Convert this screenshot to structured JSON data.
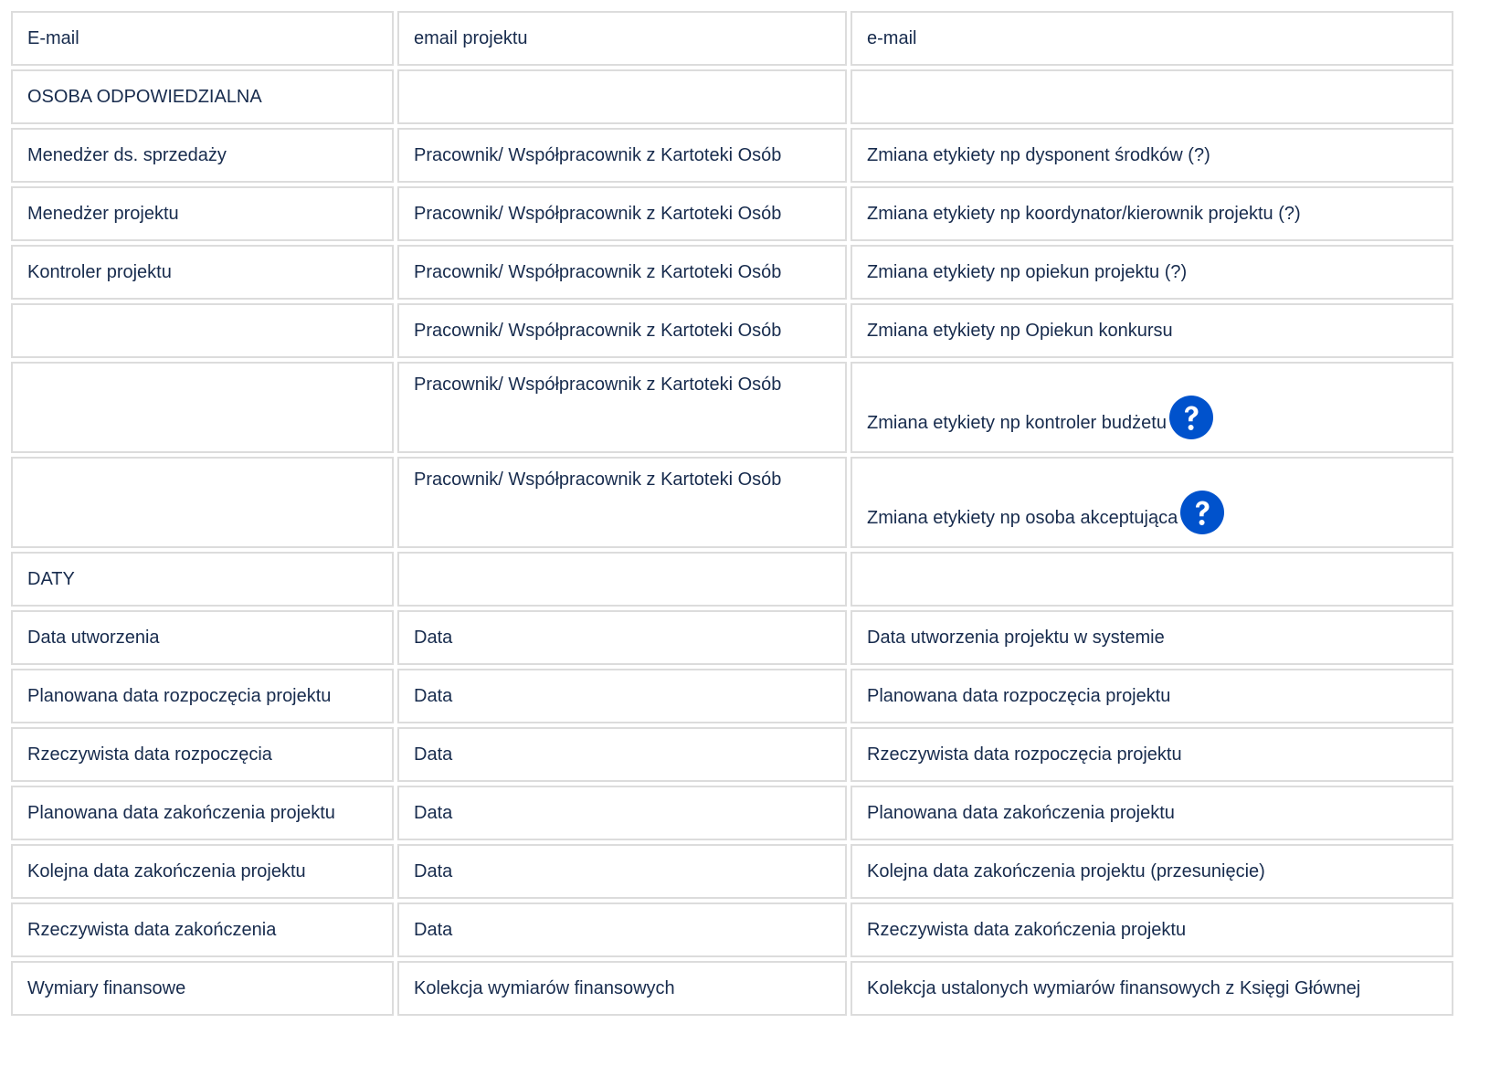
{
  "rows": [
    {
      "c1": "E-mail",
      "c2": "email projektu",
      "c3": "e-mail",
      "help": false
    },
    {
      "c1": "OSOBA ODPOWIEDZIALNA",
      "c2": "",
      "c3": "",
      "help": false
    },
    {
      "c1": "Menedżer ds. sprzedaży",
      "c2": "Pracownik/ Współpracownik z Kartoteki Osób",
      "c3": "Zmiana etykiety np dysponent środków (?)",
      "help": false
    },
    {
      "c1": "Menedżer projektu",
      "c2": "Pracownik/ Współpracownik z Kartoteki Osób",
      "c3": "Zmiana etykiety np koordynator/kierownik projektu (?)",
      "help": false
    },
    {
      "c1": "Kontroler projektu",
      "c2": "Pracownik/ Współpracownik z Kartoteki Osób",
      "c3": "Zmiana etykiety np opiekun projektu (?)",
      "help": false
    },
    {
      "c1": "",
      "c2": "Pracownik/ Współpracownik z Kartoteki Osób",
      "c3": "Zmiana etykiety np Opiekun konkursu",
      "help": false
    },
    {
      "c1": "",
      "c2": "Pracownik/ Współpracownik z Kartoteki Osób",
      "c3": "Zmiana etykiety np kontroler budżetu",
      "help": true
    },
    {
      "c1": "",
      "c2": "Pracownik/ Współpracownik z Kartoteki Osób",
      "c3": "Zmiana etykiety np osoba akceptująca",
      "help": true
    },
    {
      "c1": "DATY",
      "c2": "",
      "c3": "",
      "help": false
    },
    {
      "c1": "Data utworzenia",
      "c2": "Data",
      "c3": "Data utworzenia projektu w systemie",
      "help": false
    },
    {
      "c1": "Planowana data rozpoczęcia projektu",
      "c2": "Data",
      "c3": "Planowana data rozpoczęcia projektu",
      "help": false
    },
    {
      "c1": "Rzeczywista data rozpoczęcia",
      "c2": "Data",
      "c3": "Rzeczywista data rozpoczęcia projektu",
      "help": false
    },
    {
      "c1": "Planowana data zakończenia projektu",
      "c2": "Data",
      "c3": "Planowana data zakończenia projektu",
      "help": false
    },
    {
      "c1": "Kolejna data zakończenia projektu",
      "c2": "Data",
      "c3": "Kolejna data zakończenia projektu (przesunięcie)",
      "help": false
    },
    {
      "c1": "Rzeczywista data zakończenia",
      "c2": "Data",
      "c3": "Rzeczywista data zakończenia projektu",
      "help": false
    },
    {
      "c1": "Wymiary finansowe",
      "c2": "Kolekcja wymiarów finansowych",
      "c3": "Kolekcja ustalonych wymiarów finansowych z Księgi Głównej",
      "help": false
    }
  ],
  "colors": {
    "border": "#dcdcdc",
    "text": "#172b4d",
    "help_icon": "#0052cc"
  },
  "icons": {
    "help": "question-circle-icon"
  }
}
